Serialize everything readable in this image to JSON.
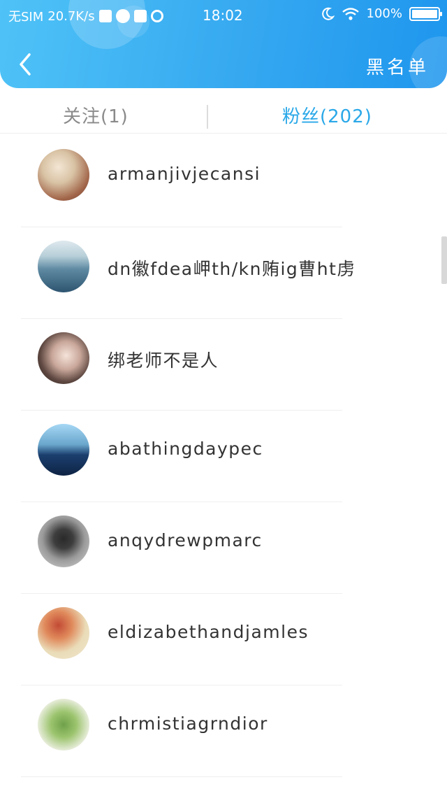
{
  "status_bar": {
    "carrier": "无SIM",
    "speed": "20.7K/s",
    "time": "18:02",
    "battery": "100%"
  },
  "header": {
    "blacklist_label": "黑名单",
    "back_icon": "chevron-left-icon"
  },
  "tabs": {
    "follow_label": "关注(1)",
    "fans_label": "粉丝(202)"
  },
  "colors": {
    "accent": "#2aa8e8",
    "header_start": "#4fc3f7",
    "header_end": "#1e96ee"
  },
  "fans": [
    {
      "name": "armanjivjecansi"
    },
    {
      "name": "dn徽fdea岬th/kn贿ig曹ht虏"
    },
    {
      "name": "绑老师不是人"
    },
    {
      "name": "abathingdaypec"
    },
    {
      "name": "anqydrewpmarc"
    },
    {
      "name": "eldizabethandjamles"
    },
    {
      "name": "chrmistiagrndior"
    }
  ]
}
